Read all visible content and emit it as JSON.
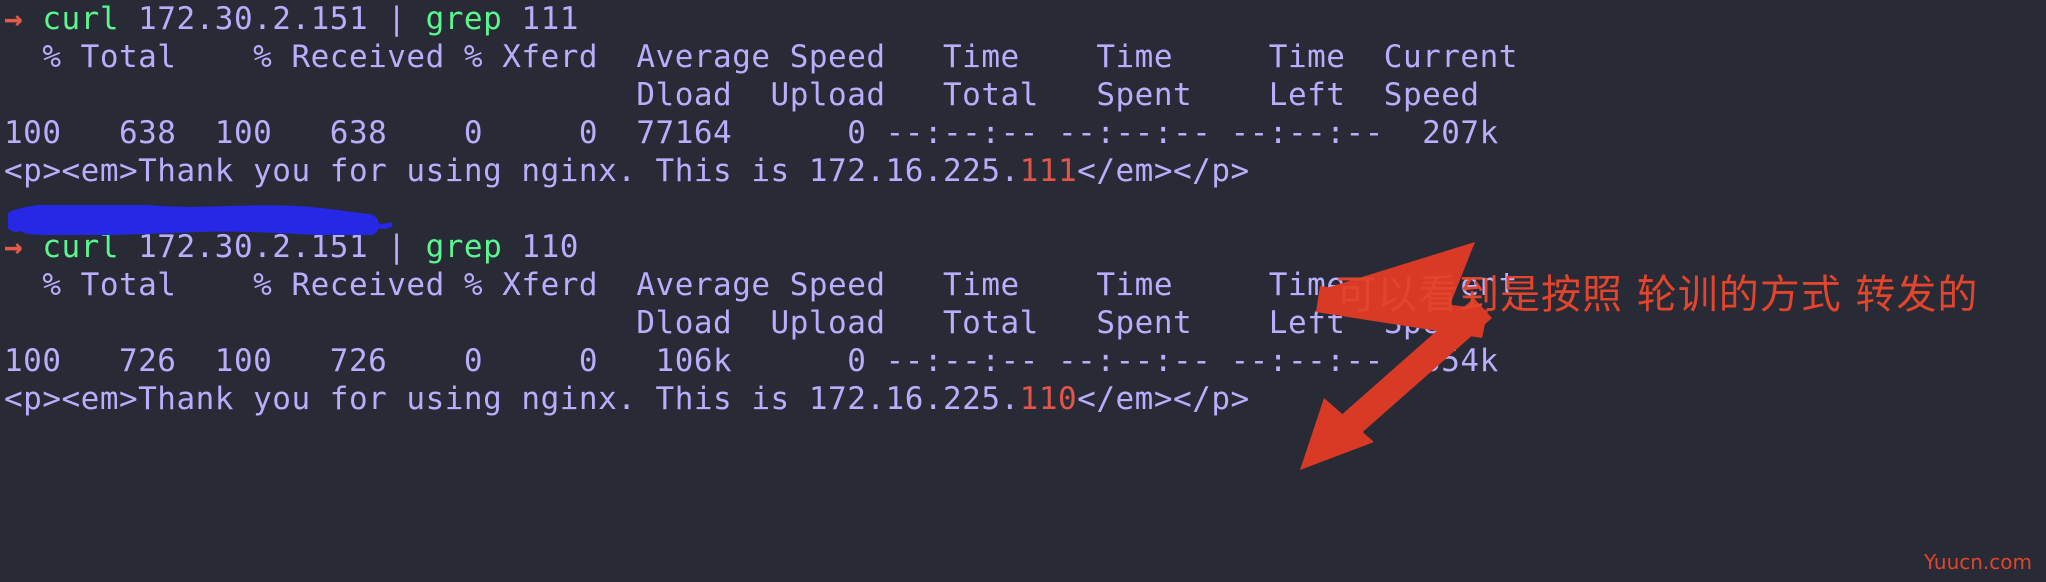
{
  "terminal": {
    "background_color": "#282a36",
    "foreground_color": "#bd93f9",
    "prompt_symbol": "→",
    "prompt_color": "#e35b4a",
    "command_color": "#5af78e",
    "match_color": "#e2564a",
    "lines": [
      {
        "type": "prompt",
        "prompt": "→",
        "segments": [
          {
            "name": "command-curl",
            "text": "curl",
            "color": "cmd"
          },
          {
            "name": "command-arg-host",
            "text": " 172.30.2.151 | ",
            "color": "plain"
          },
          {
            "name": "command-grep",
            "text": "grep",
            "color": "cmd"
          },
          {
            "name": "command-arg-pattern",
            "text": " 111",
            "color": "plain"
          }
        ]
      },
      {
        "type": "output",
        "name": "curl-progress-header-1",
        "text": "  % Total    % Received % Xferd  Average Speed   Time    Time     Time  Current"
      },
      {
        "type": "output",
        "name": "curl-progress-header-2",
        "text": "                                 Dload  Upload   Total   Spent    Left  Speed"
      },
      {
        "type": "output",
        "name": "curl-progress-values-1",
        "text": "100   638  100   638    0     0  77164      0 --:--:-- --:--:-- --:--:--  207k"
      },
      {
        "type": "grep-result",
        "name": "nginx-response-1",
        "prefix": "<p><em>Thank you for using nginx. This is 172.16.225.",
        "match": "111",
        "suffix": "</em></p>"
      },
      {
        "type": "blank",
        "name": "redacted-line"
      },
      {
        "type": "prompt",
        "prompt": "→",
        "segments": [
          {
            "name": "command-curl",
            "text": "curl",
            "color": "cmd"
          },
          {
            "name": "command-arg-host",
            "text": " 172.30.2.151 | ",
            "color": "plain"
          },
          {
            "name": "command-grep",
            "text": "grep",
            "color": "cmd"
          },
          {
            "name": "command-arg-pattern",
            "text": " 110",
            "color": "plain"
          }
        ]
      },
      {
        "type": "output",
        "name": "curl-progress-header-1",
        "text": "  % Total    % Received % Xferd  Average Speed   Time    Time     Time  Current"
      },
      {
        "type": "output",
        "name": "curl-progress-header-2",
        "text": "                                 Dload  Upload   Total   Spent    Left  Speed"
      },
      {
        "type": "output",
        "name": "curl-progress-values-2",
        "text": "100   726  100   726    0     0   106k      0 --:--:-- --:--:-- --:--:--  354k"
      },
      {
        "type": "grep-result",
        "name": "nginx-response-2",
        "prefix": "<p><em>Thank you for using nginx. This is 172.16.225.",
        "match": "110",
        "suffix": "</em></p>"
      }
    ]
  },
  "annotations": {
    "note_text": "可以看到是按照 轮训的方式 转发的",
    "note_color": "#e2452c",
    "arrow_color": "#d93a26",
    "redaction_color": "#2727e6"
  },
  "watermark": {
    "text": "Yuucn.com",
    "color": "#e2452c"
  }
}
